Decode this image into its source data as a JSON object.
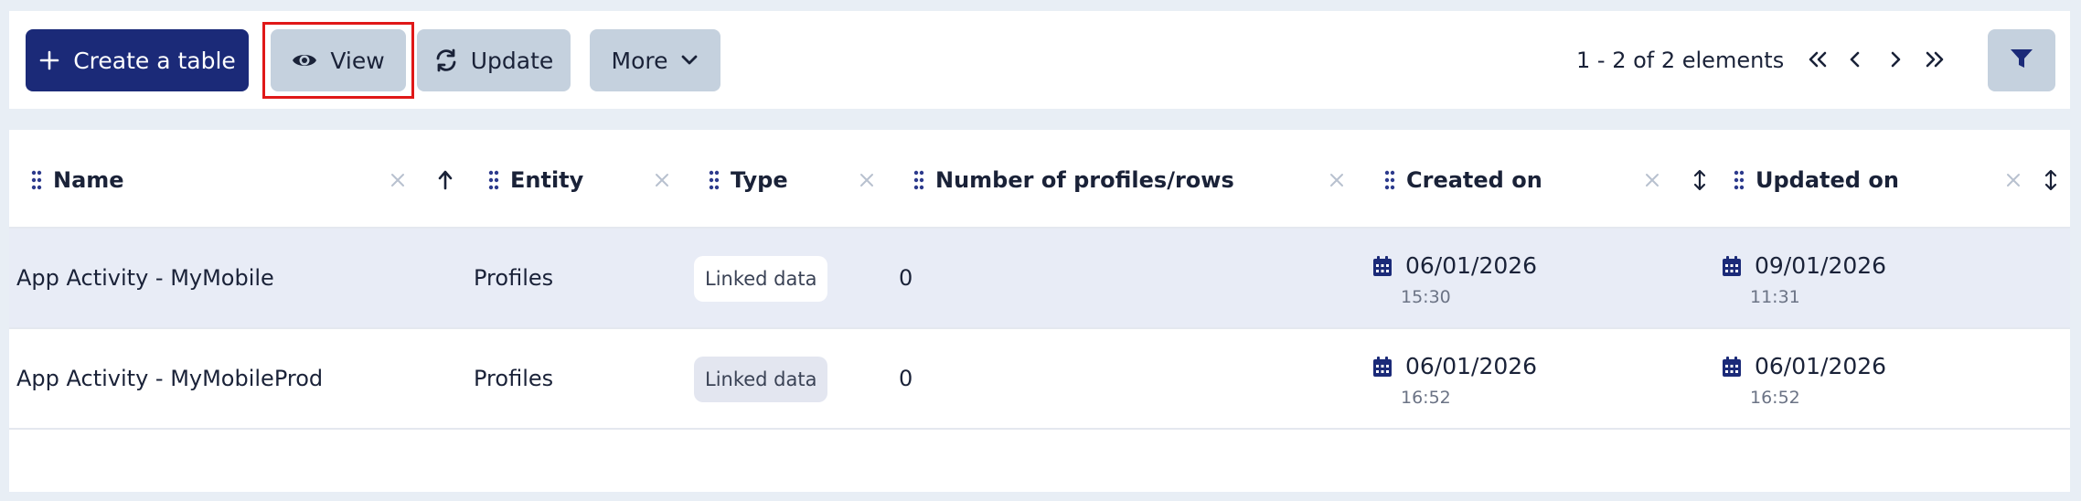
{
  "toolbar": {
    "create_label": "Create a table",
    "view_label": "View",
    "update_label": "Update",
    "more_label": "More",
    "pagination_text": "1 - 2 of 2 elements"
  },
  "icons": {
    "create": "plus-icon",
    "view": "eye-icon",
    "update": "refresh-icon",
    "more": "chevron-down-icon",
    "first": "double-chevron-left-icon",
    "prev": "chevron-left-icon",
    "next": "chevron-right-icon",
    "last": "double-chevron-right-icon",
    "filter": "filter-icon",
    "date": "calendar-icon"
  },
  "table": {
    "columns": [
      {
        "label": "Name"
      },
      {
        "label": "Entity"
      },
      {
        "label": "Type"
      },
      {
        "label": "Number of profiles/rows"
      },
      {
        "label": "Created on"
      },
      {
        "label": "Updated on"
      }
    ],
    "rows": [
      {
        "name": "App Activity - MyMobile",
        "entity": "Profiles",
        "type": "Linked data",
        "count": "0",
        "created_date": "06/01/2026",
        "created_time": "15:30",
        "updated_date": "09/01/2026",
        "updated_time": "11:31"
      },
      {
        "name": "App Activity - MyMobileProd",
        "entity": "Profiles",
        "type": "Linked data",
        "count": "0",
        "created_date": "06/01/2026",
        "created_time": "16:52",
        "updated_date": "06/01/2026",
        "updated_time": "16:52"
      }
    ]
  },
  "colors": {
    "primary": "#1b2a78",
    "secondary": "#c5d1de",
    "highlight": "#e01818",
    "selected_row": "#e8ecf6"
  }
}
